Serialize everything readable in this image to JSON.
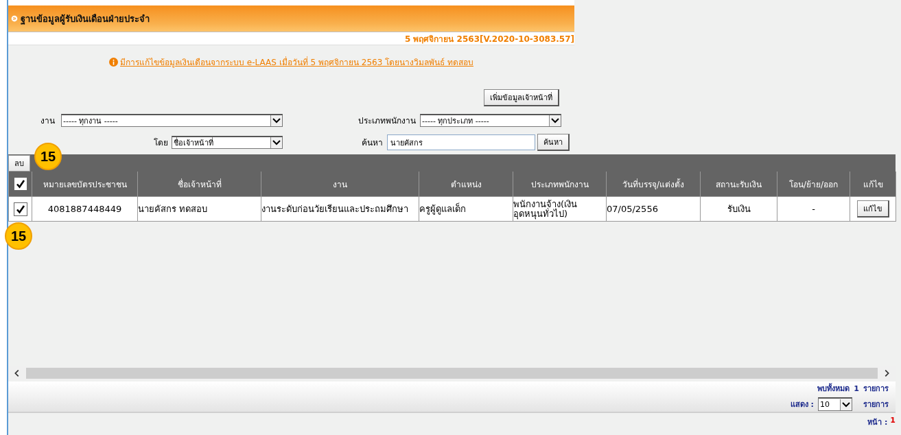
{
  "header": {
    "title": "ฐานข้อมูลผู้รับเงินเดือนฝ่ายประจำ",
    "version": "5 พฤศจิกายน 2563[V.2020-10-3083.57]",
    "notice": "มีการแก้ไขข้อมูลเงินเดือนจากระบบ e-LAAS เมื่อวันที่ 5 พฤศจิกายน 2563 โดยนางวิมลพันธ์ ทดสอบ"
  },
  "add_button": "เพิ่มข้อมูลเจ้าหน้าที่",
  "filters": {
    "work": {
      "label": "งาน",
      "value": "----- ทุกงาน -----"
    },
    "staff_type": {
      "label": "ประเภทพนักงาน",
      "value": "----- ทุกประเภท -----"
    },
    "by": {
      "label": "โดย",
      "value": "ชื่อเจ้าหน้าที่"
    },
    "search": {
      "label": "ค้นหา",
      "value": "นายคัสกร",
      "button": "ค้นหา"
    }
  },
  "toolbar": {
    "delete_button": "ลบ"
  },
  "callouts": [
    "15",
    "15"
  ],
  "table": {
    "select_all_checked": true,
    "columns": [
      "หมายเลขบัตรประชาชน",
      "ชื่อเจ้าหน้าที่",
      "งาน",
      "ตำแหน่ง",
      "ประเภทพนักงาน",
      "วันที่บรรจุ/แต่งตั้ง",
      "สถานะรับเงิน",
      "โอน/ย้าย/ออก",
      "แก้ไข"
    ],
    "rows": [
      {
        "checked": true,
        "cells": [
          "4081887448449",
          "นายคัสกร ทดสอบ",
          "งานระดับก่อนวัยเรียนและประถมศึกษา",
          "ครูผู้ดูแลเด็ก",
          "พนักงานจ้าง(เงินอุดหนุนทั่วไป)",
          "07/05/2556",
          "รับเงิน",
          "-"
        ],
        "edit_button": "แก้ไข"
      }
    ]
  },
  "footer": {
    "total_label": "พบทั้งหมด",
    "total": "1",
    "total_unit": "รายการ",
    "show_label": "แสดง :",
    "page_size": "10",
    "show_unit": "รายการ",
    "page_label": "หน้า :",
    "page": "1"
  }
}
